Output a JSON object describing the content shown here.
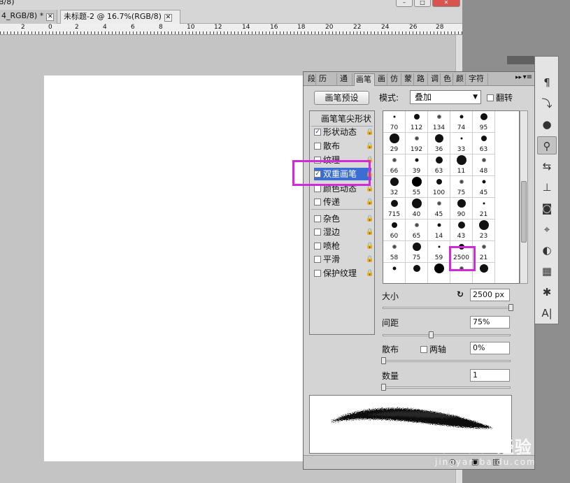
{
  "window": {
    "title_fragment": "B/8)"
  },
  "doc_tabs": [
    {
      "label": "4_RGB/8) *"
    },
    {
      "label": "未标题-2 @ 16.7%(RGB/8)"
    }
  ],
  "window_buttons": [
    "–",
    "□",
    "✕"
  ],
  "ruler": {
    "labels": [
      "2",
      "0",
      "2",
      "4",
      "6",
      "8",
      "10",
      "12",
      "14",
      "16",
      "18",
      "20",
      "22",
      "24",
      "26",
      "28"
    ]
  },
  "dock": {
    "header": "▸▸ ✕",
    "icons": [
      "paragraph-icon",
      "history-brush-icon",
      "color-sphere-icon",
      "brush-icon",
      "tool-presets-icon",
      "clone-stamp-icon",
      "camera-icon",
      "transform-icon",
      "mask-icon",
      "grid-icon",
      "palette-icon",
      "text-icon"
    ],
    "glyphs": [
      "¶",
      "⤵",
      "●",
      "⚲",
      "⇆",
      "⊥",
      "◙",
      "⌖",
      "◐",
      "▦",
      "✱",
      "A|"
    ]
  },
  "panel": {
    "header_arrows": "▸▸",
    "tabs": [
      "段",
      "历",
      "通",
      "画笔",
      "画",
      "仿",
      "蒙",
      "路",
      "调",
      "色",
      "颜",
      "字符"
    ],
    "active_tab": "画笔",
    "preset_button": "画笔预设",
    "mode_label": "模式:",
    "mode_value": "叠加",
    "flip_label": "翻转",
    "left_items": [
      {
        "label": "画笔笔尖形状",
        "checked": false,
        "checkbox": false
      },
      {
        "label": "形状动态",
        "checked": true,
        "checkbox": true
      },
      {
        "label": "散布",
        "checked": false,
        "checkbox": true
      },
      {
        "label": "纹理",
        "checked": false,
        "checkbox": true
      },
      {
        "label": "双重画笔",
        "checked": true,
        "checkbox": true,
        "selected": true
      },
      {
        "label": "颜色动态",
        "checked": false,
        "checkbox": true
      },
      {
        "label": "传递",
        "checked": false,
        "checkbox": true
      },
      {
        "label": "杂色",
        "checked": false,
        "checkbox": true
      },
      {
        "label": "湿边",
        "checked": false,
        "checkbox": true
      },
      {
        "label": "喷枪",
        "checked": false,
        "checkbox": true
      },
      {
        "label": "平滑",
        "checked": false,
        "checkbox": true
      },
      {
        "label": "保护纹理",
        "checked": false,
        "checkbox": true
      }
    ],
    "brush_sizes": [
      "70",
      "112",
      "134",
      "74",
      "95",
      "29",
      "192",
      "36",
      "33",
      "63",
      "66",
      "39",
      "63",
      "11",
      "48",
      "32",
      "55",
      "100",
      "75",
      "45",
      "715",
      "40",
      "45",
      "90",
      "21",
      "60",
      "65",
      "14",
      "43",
      "23",
      "58",
      "75",
      "59",
      "2500",
      "21",
      "",
      "",
      "",
      "",
      ""
    ],
    "selected_brush": "2500",
    "size_label": "大小",
    "size_value": "2500 px",
    "spacing_label": "间距",
    "spacing_value": "75%",
    "spacing_fraction": 0.37,
    "scatter_label": "散布",
    "both_axes_label": "两轴",
    "scatter_value": "0%",
    "count_label": "数量",
    "count_value": "1"
  },
  "watermark": {
    "text": "Bai du 经验",
    "url": "jingyan.baidu.com"
  },
  "colors": {
    "highlight": "#d02bd9",
    "selection": "#3b6ed4"
  }
}
